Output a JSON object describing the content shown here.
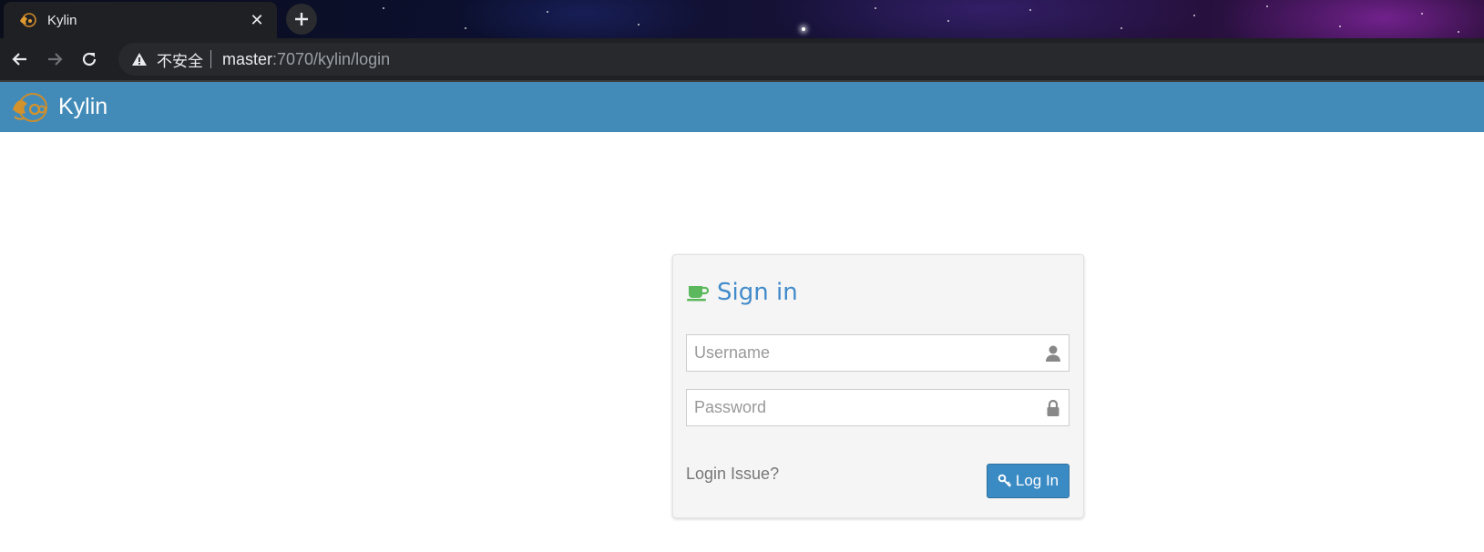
{
  "browser": {
    "tab": {
      "title": "Kylin",
      "close_glyph": "✕"
    },
    "new_tab_icon": "plus-icon",
    "address_bar": {
      "security_label": "不安全",
      "url_host": "master",
      "url_rest": ":7070/kylin/login"
    }
  },
  "app": {
    "name": "Kylin",
    "header_color": "#428bb9"
  },
  "login": {
    "title": "Sign in",
    "title_icon": "coffee-cup-icon",
    "username": {
      "placeholder": "Username",
      "value": "",
      "icon": "user-icon"
    },
    "password": {
      "placeholder": "Password",
      "value": "",
      "icon": "lock-icon"
    },
    "issue_link": "Login Issue?",
    "submit_label": "Log In",
    "submit_icon": "key-icon",
    "accent_color": "#428bca"
  }
}
